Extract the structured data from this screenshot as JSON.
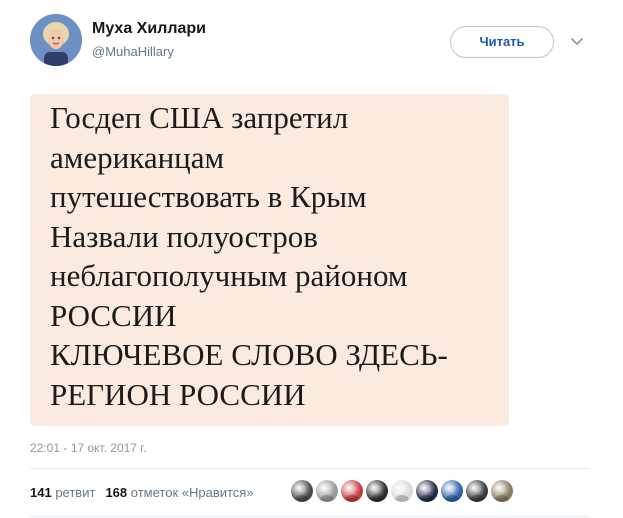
{
  "author": {
    "name": "Муха Хиллари",
    "handle": "@MuhaHillary"
  },
  "follow_button": {
    "label": "Читать"
  },
  "tweet": {
    "lines": [
      "Госдеп США запретил",
      "американцам",
      "путешествовать в Крым",
      "Назвали полуостров",
      "неблагополучным районом",
      "РОССИИ",
      "КЛЮЧЕВОЕ СЛОВО ЗДЕСЬ-",
      "РЕГИОН РОССИИ"
    ],
    "background_color": "#fbeadf",
    "timestamp": "22:01 - 17 окт. 2017 г."
  },
  "stats": {
    "retweets_count": "141",
    "retweets_label": "ретвит",
    "likes_count": "168",
    "likes_label": "отметок «Нравится»"
  },
  "likers": [
    {
      "icon": "liker-avatar-1",
      "color": "#4a4a4a"
    },
    {
      "icon": "liker-avatar-2",
      "color": "#9a9a9a"
    },
    {
      "icon": "liker-avatar-3",
      "color": "#c23b3b"
    },
    {
      "icon": "liker-avatar-4",
      "color": "#2b2b2b"
    },
    {
      "icon": "liker-avatar-5",
      "color": "#d9d9d9"
    },
    {
      "icon": "liker-avatar-6",
      "color": "#1f2a44"
    },
    {
      "icon": "liker-avatar-7",
      "color": "#2f5fa8"
    },
    {
      "icon": "liker-avatar-8",
      "color": "#3a3a3a"
    },
    {
      "icon": "liker-avatar-9",
      "color": "#8a7a60"
    }
  ],
  "colors": {
    "accent": "#1d5aa7",
    "muted_text": "#657786",
    "timestamp_text": "#8899a6"
  }
}
